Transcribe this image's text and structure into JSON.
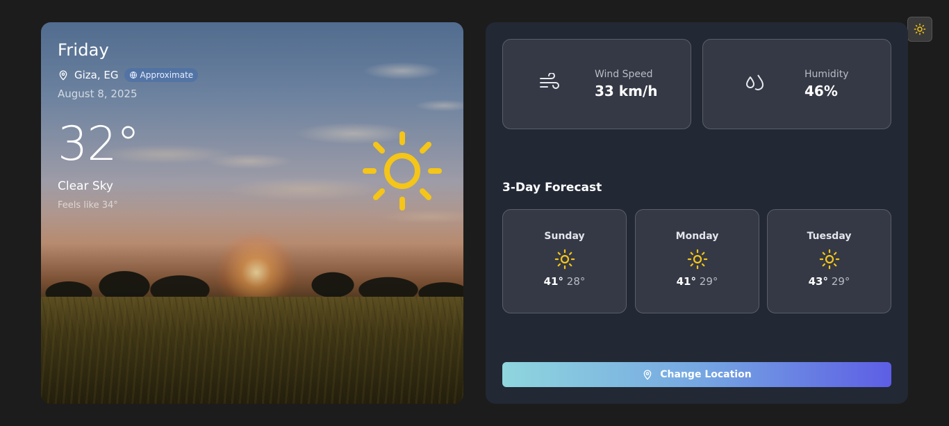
{
  "hero": {
    "day": "Friday",
    "location": "Giza, EG",
    "badge": "Approximate",
    "date": "August 8, 2025",
    "temperature": "32°",
    "condition": "Clear Sky",
    "feels_like": "Feels like 34°",
    "weather_icon": "sun-icon"
  },
  "stats": {
    "wind": {
      "label": "Wind Speed",
      "value": "33 km/h",
      "icon": "wind-icon"
    },
    "humidity": {
      "label": "Humidity",
      "value": "46%",
      "icon": "humidity-icon"
    }
  },
  "forecast": {
    "title": "3-Day Forecast",
    "days": [
      {
        "day": "Sunday",
        "high": "41°",
        "low": "28°",
        "icon": "sun-icon"
      },
      {
        "day": "Monday",
        "high": "41°",
        "low": "29°",
        "icon": "sun-icon"
      },
      {
        "day": "Tuesday",
        "high": "43°",
        "low": "29°",
        "icon": "sun-icon"
      }
    ]
  },
  "actions": {
    "change_location": "Change Location"
  },
  "colors": {
    "sun": "#f5c518",
    "panel": "#222834",
    "card": "#353945",
    "button_start": "#8fd6de",
    "button_end": "#5d5ee4"
  }
}
